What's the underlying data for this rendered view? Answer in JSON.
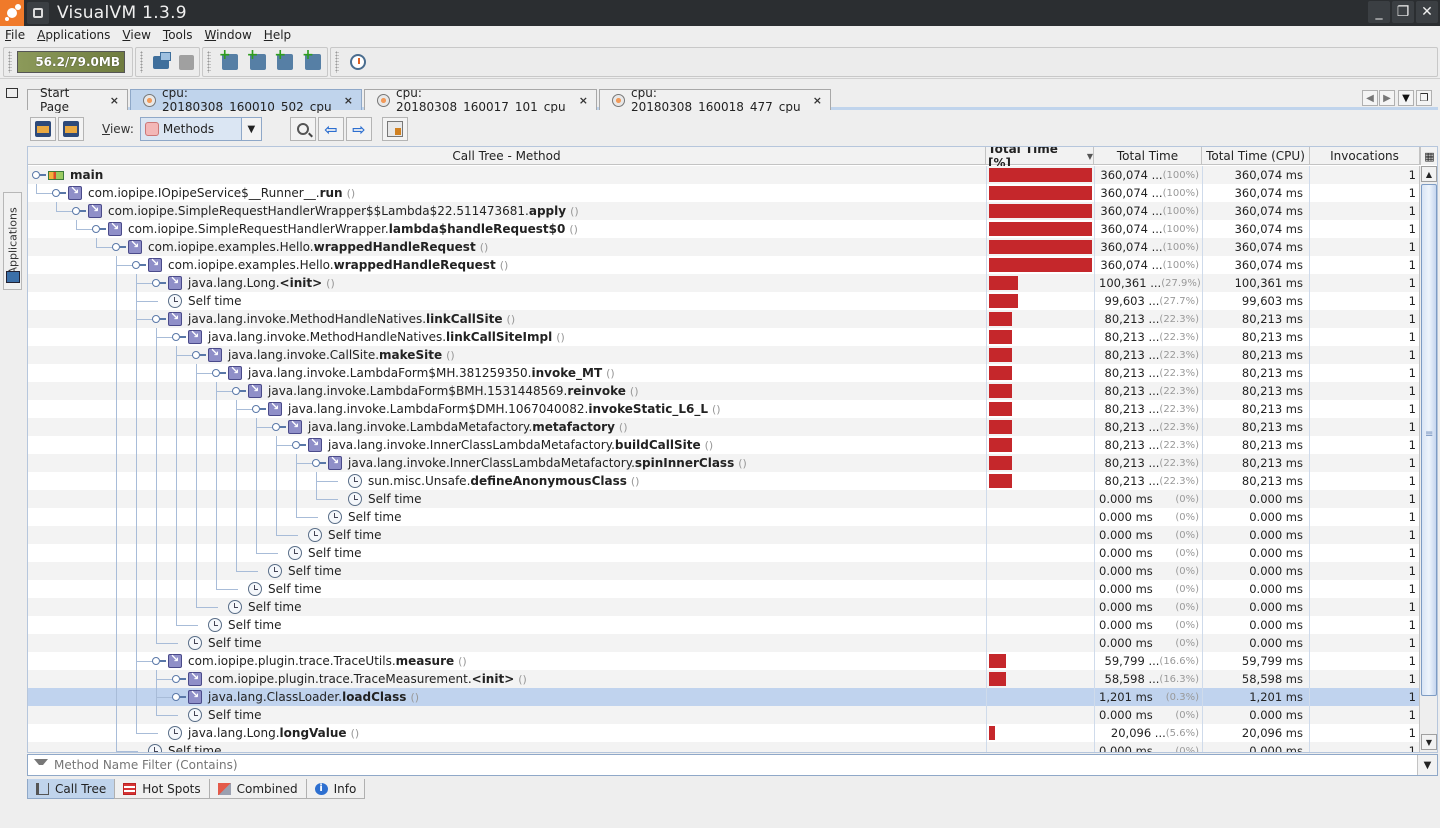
{
  "window": {
    "title": "VisualVM 1.3.9",
    "controls": {
      "minimize": "_",
      "maximize": "❐",
      "close": "✕"
    }
  },
  "menubar": [
    {
      "label": "File",
      "mnemonic": "F",
      "rest": "ile"
    },
    {
      "label": "Applications",
      "mnemonic": "A",
      "rest": "pplications"
    },
    {
      "label": "View",
      "mnemonic": "V",
      "rest": "iew"
    },
    {
      "label": "Tools",
      "mnemonic": "T",
      "rest": "ools"
    },
    {
      "label": "Window",
      "mnemonic": "W",
      "rest": "indow"
    },
    {
      "label": "Help",
      "mnemonic": "H",
      "rest": "elp"
    }
  ],
  "toolbar": {
    "memory": "56.2/79.0MB",
    "buttons": [
      "load-snapshot",
      "save-snapshot",
      "add-jmx-connection",
      "add-jmx",
      "add-core-dump",
      "add-snapshot",
      "profile-startup"
    ]
  },
  "sidebar": {
    "applications_tab": "Applications"
  },
  "tabs": [
    {
      "label": "Start Page",
      "active": false,
      "icon": "none"
    },
    {
      "label": "cpu: 20180308_160010_502_cpu",
      "active": true,
      "icon": "stopwatch-icon"
    },
    {
      "label": "cpu: 20180308_160017_101_cpu",
      "active": false,
      "icon": "stopwatch-icon"
    },
    {
      "label": "cpu: 20180308_160018_477_cpu",
      "active": false,
      "icon": "stopwatch-icon"
    }
  ],
  "tab_close": "×",
  "viewbar": {
    "view_label": "View:",
    "view_mnemonic": "V",
    "view_rest": "iew:",
    "view_selected": "Methods"
  },
  "table": {
    "columns": [
      "Call Tree - Method",
      "Total Time [%]",
      "Total Time",
      "Total Time (CPU)",
      "Invocations"
    ],
    "sort_indicator": "▼",
    "rows": [
      {
        "depth": 0,
        "icon": "thread",
        "expander": true,
        "pkg": "",
        "meth": "main",
        "parens": false,
        "pct": 100,
        "total": "360,074 ...",
        "pctlabel": "(100%)",
        "cpu": "360,074 ms",
        "inv": "1"
      },
      {
        "depth": 1,
        "icon": "method",
        "expander": true,
        "pkg": "com.iopipe.IOpipeService$__Runner__.",
        "meth": "run",
        "parens": true,
        "pct": 100,
        "total": "360,074 ...",
        "pctlabel": "(100%)",
        "cpu": "360,074 ms",
        "inv": "1"
      },
      {
        "depth": 2,
        "icon": "method",
        "expander": true,
        "pkg": "com.iopipe.SimpleRequestHandlerWrapper$$Lambda$22.511473681.",
        "meth": "apply",
        "parens": true,
        "pct": 100,
        "total": "360,074 ...",
        "pctlabel": "(100%)",
        "cpu": "360,074 ms",
        "inv": "1"
      },
      {
        "depth": 3,
        "icon": "method",
        "expander": true,
        "pkg": "com.iopipe.SimpleRequestHandlerWrapper.",
        "meth": "lambda$handleRequest$0",
        "parens": true,
        "pct": 100,
        "total": "360,074 ...",
        "pctlabel": "(100%)",
        "cpu": "360,074 ms",
        "inv": "1"
      },
      {
        "depth": 4,
        "icon": "method",
        "expander": true,
        "pkg": "com.iopipe.examples.Hello.",
        "meth": "wrappedHandleRequest",
        "parens": true,
        "pct": 100,
        "total": "360,074 ...",
        "pctlabel": "(100%)",
        "cpu": "360,074 ms",
        "inv": "1"
      },
      {
        "depth": 5,
        "icon": "method",
        "expander": true,
        "pkg": "com.iopipe.examples.Hello.",
        "meth": "wrappedHandleRequest",
        "parens": true,
        "pct": 100,
        "total": "360,074 ...",
        "pctlabel": "(100%)",
        "cpu": "360,074 ms",
        "inv": "1"
      },
      {
        "depth": 6,
        "icon": "method",
        "expander": true,
        "collapsed": true,
        "pkg": "java.lang.Long.",
        "meth": "<init>",
        "parens": true,
        "pct": 27.9,
        "total": "100,361 ...",
        "pctlabel": "(27.9%)",
        "cpu": "100,361 ms",
        "inv": "1"
      },
      {
        "depth": 6,
        "icon": "clock",
        "expander": false,
        "pkg": "Self time",
        "meth": "",
        "parens": false,
        "pct": 27.7,
        "total": "99,603 ...",
        "pctlabel": "(27.7%)",
        "cpu": "99,603 ms",
        "inv": "1"
      },
      {
        "depth": 6,
        "icon": "method",
        "expander": true,
        "pkg": "java.lang.invoke.MethodHandleNatives.",
        "meth": "linkCallSite",
        "parens": true,
        "pct": 22.3,
        "total": "80,213 ...",
        "pctlabel": "(22.3%)",
        "cpu": "80,213 ms",
        "inv": "1"
      },
      {
        "depth": 7,
        "icon": "method",
        "expander": true,
        "pkg": "java.lang.invoke.MethodHandleNatives.",
        "meth": "linkCallSiteImpl",
        "parens": true,
        "pct": 22.3,
        "total": "80,213 ...",
        "pctlabel": "(22.3%)",
        "cpu": "80,213 ms",
        "inv": "1"
      },
      {
        "depth": 8,
        "icon": "method",
        "expander": true,
        "pkg": "java.lang.invoke.CallSite.",
        "meth": "makeSite",
        "parens": true,
        "pct": 22.3,
        "total": "80,213 ...",
        "pctlabel": "(22.3%)",
        "cpu": "80,213 ms",
        "inv": "1"
      },
      {
        "depth": 9,
        "icon": "method",
        "expander": true,
        "pkg": "java.lang.invoke.LambdaForm$MH.381259350.",
        "meth": "invoke_MT",
        "parens": true,
        "pct": 22.3,
        "total": "80,213 ...",
        "pctlabel": "(22.3%)",
        "cpu": "80,213 ms",
        "inv": "1"
      },
      {
        "depth": 10,
        "icon": "method",
        "expander": true,
        "pkg": "java.lang.invoke.LambdaForm$BMH.1531448569.",
        "meth": "reinvoke",
        "parens": true,
        "pct": 22.3,
        "total": "80,213 ...",
        "pctlabel": "(22.3%)",
        "cpu": "80,213 ms",
        "inv": "1"
      },
      {
        "depth": 11,
        "icon": "method",
        "expander": true,
        "pkg": "java.lang.invoke.LambdaForm$DMH.1067040082.",
        "meth": "invokeStatic_L6_L",
        "parens": true,
        "pct": 22.3,
        "total": "80,213 ...",
        "pctlabel": "(22.3%)",
        "cpu": "80,213 ms",
        "inv": "1"
      },
      {
        "depth": 12,
        "icon": "method",
        "expander": true,
        "pkg": "java.lang.invoke.LambdaMetafactory.",
        "meth": "metafactory",
        "parens": true,
        "pct": 22.3,
        "total": "80,213 ...",
        "pctlabel": "(22.3%)",
        "cpu": "80,213 ms",
        "inv": "1"
      },
      {
        "depth": 13,
        "icon": "method",
        "expander": true,
        "pkg": "java.lang.invoke.InnerClassLambdaMetafactory.",
        "meth": "buildCallSite",
        "parens": true,
        "pct": 22.3,
        "total": "80,213 ...",
        "pctlabel": "(22.3%)",
        "cpu": "80,213 ms",
        "inv": "1"
      },
      {
        "depth": 14,
        "icon": "method",
        "expander": true,
        "pkg": "java.lang.invoke.InnerClassLambdaMetafactory.",
        "meth": "spinInnerClass",
        "parens": true,
        "pct": 22.3,
        "total": "80,213 ...",
        "pctlabel": "(22.3%)",
        "cpu": "80,213 ms",
        "inv": "1"
      },
      {
        "depth": 15,
        "icon": "clock",
        "expander": false,
        "pkg": "sun.misc.Unsafe.",
        "meth": "defineAnonymousClass",
        "parens": true,
        "pct": 22.3,
        "total": "80,213 ...",
        "pctlabel": "(22.3%)",
        "cpu": "80,213 ms",
        "inv": "1"
      },
      {
        "depth": 15,
        "icon": "clock",
        "expander": false,
        "pkg": "Self time",
        "meth": "",
        "parens": false,
        "pct": 0,
        "total": "0.000 ms",
        "pctlabel": "(0%)",
        "cpu": "0.000 ms",
        "inv": "1"
      },
      {
        "depth": 14,
        "icon": "clock",
        "expander": false,
        "pkg": "Self time",
        "meth": "",
        "parens": false,
        "pct": 0,
        "total": "0.000 ms",
        "pctlabel": "(0%)",
        "cpu": "0.000 ms",
        "inv": "1"
      },
      {
        "depth": 13,
        "icon": "clock",
        "expander": false,
        "pkg": "Self time",
        "meth": "",
        "parens": false,
        "pct": 0,
        "total": "0.000 ms",
        "pctlabel": "(0%)",
        "cpu": "0.000 ms",
        "inv": "1"
      },
      {
        "depth": 12,
        "icon": "clock",
        "expander": false,
        "pkg": "Self time",
        "meth": "",
        "parens": false,
        "pct": 0,
        "total": "0.000 ms",
        "pctlabel": "(0%)",
        "cpu": "0.000 ms",
        "inv": "1"
      },
      {
        "depth": 11,
        "icon": "clock",
        "expander": false,
        "pkg": "Self time",
        "meth": "",
        "parens": false,
        "pct": 0,
        "total": "0.000 ms",
        "pctlabel": "(0%)",
        "cpu": "0.000 ms",
        "inv": "1"
      },
      {
        "depth": 10,
        "icon": "clock",
        "expander": false,
        "pkg": "Self time",
        "meth": "",
        "parens": false,
        "pct": 0,
        "total": "0.000 ms",
        "pctlabel": "(0%)",
        "cpu": "0.000 ms",
        "inv": "1"
      },
      {
        "depth": 9,
        "icon": "clock",
        "expander": false,
        "pkg": "Self time",
        "meth": "",
        "parens": false,
        "pct": 0,
        "total": "0.000 ms",
        "pctlabel": "(0%)",
        "cpu": "0.000 ms",
        "inv": "1"
      },
      {
        "depth": 8,
        "icon": "clock",
        "expander": false,
        "pkg": "Self time",
        "meth": "",
        "parens": false,
        "pct": 0,
        "total": "0.000 ms",
        "pctlabel": "(0%)",
        "cpu": "0.000 ms",
        "inv": "1"
      },
      {
        "depth": 7,
        "icon": "clock",
        "expander": false,
        "pkg": "Self time",
        "meth": "",
        "parens": false,
        "pct": 0,
        "total": "0.000 ms",
        "pctlabel": "(0%)",
        "cpu": "0.000 ms",
        "inv": "1"
      },
      {
        "depth": 6,
        "icon": "method",
        "expander": true,
        "pkg": "com.iopipe.plugin.trace.TraceUtils.",
        "meth": "measure",
        "parens": true,
        "pct": 16.6,
        "total": "59,799 ...",
        "pctlabel": "(16.6%)",
        "cpu": "59,799 ms",
        "inv": "1"
      },
      {
        "depth": 7,
        "icon": "method",
        "expander": true,
        "collapsed": true,
        "pkg": "com.iopipe.plugin.trace.TraceMeasurement.",
        "meth": "<init>",
        "parens": true,
        "pct": 16.3,
        "total": "58,598 ...",
        "pctlabel": "(16.3%)",
        "cpu": "58,598 ms",
        "inv": "1"
      },
      {
        "depth": 7,
        "icon": "method",
        "expander": true,
        "collapsed": true,
        "selected": true,
        "pkg": "java.lang.ClassLoader.",
        "meth": "loadClass",
        "parens": true,
        "pct": 0.3,
        "total": "1,201 ms",
        "pctlabel": "(0.3%)",
        "cpu": "1,201 ms",
        "inv": "1"
      },
      {
        "depth": 7,
        "icon": "clock",
        "expander": false,
        "pkg": "Self time",
        "meth": "",
        "parens": false,
        "pct": 0,
        "total": "0.000 ms",
        "pctlabel": "(0%)",
        "cpu": "0.000 ms",
        "inv": "1"
      },
      {
        "depth": 6,
        "icon": "clock",
        "expander": false,
        "pkg": "java.lang.Long.",
        "meth": "longValue",
        "parens": true,
        "pct": 5.6,
        "total": "20,096 ...",
        "pctlabel": "(5.6%)",
        "cpu": "20,096 ms",
        "inv": "1"
      },
      {
        "depth": 5,
        "icon": "clock",
        "expander": false,
        "pkg": "Self time",
        "meth": "",
        "parens": false,
        "pct": 0,
        "total": "0.000 ms",
        "pctlabel": "(0%)",
        "cpu": "0.000 ms",
        "inv": "1"
      }
    ]
  },
  "filter": {
    "placeholder": "Method Name Filter (Contains)"
  },
  "bottom_tabs": [
    {
      "label": "Call Tree",
      "active": true,
      "icon": "tree"
    },
    {
      "label": "Hot Spots",
      "active": false,
      "icon": "grid"
    },
    {
      "label": "Combined",
      "active": false,
      "icon": "combo"
    },
    {
      "label": "Info",
      "active": false,
      "icon": "info"
    }
  ],
  "colors": {
    "bar": "#c5272b",
    "selection": "#c0d3ee",
    "active_tab": "#c0d4ec"
  }
}
